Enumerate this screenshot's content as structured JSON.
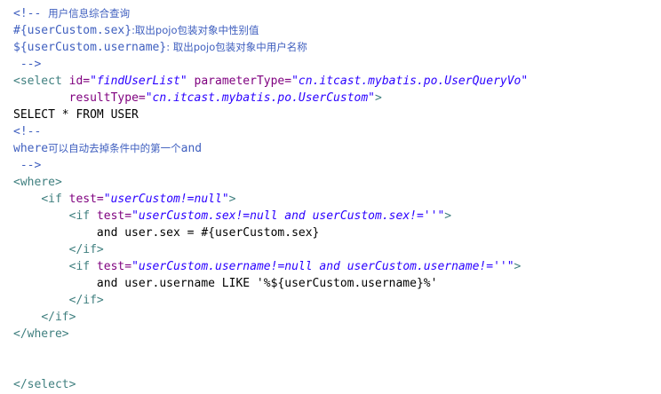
{
  "editor": {
    "lines": [
      {
        "tokens": [
          {
            "text": "<!-- ",
            "kind": "comment"
          },
          {
            "text": "用户信息综合查询",
            "kind": "comment cjk"
          }
        ]
      },
      {
        "tokens": [
          {
            "text": "#{userCustom.sex}",
            "kind": "comment"
          },
          {
            "text": ":取出pojo包装对象中性别值",
            "kind": "comment cjk"
          }
        ]
      },
      {
        "tokens": [
          {
            "text": "${userCustom.username}",
            "kind": "comment"
          },
          {
            "text": ": 取出pojo包装对象中用户名称",
            "kind": "comment cjk"
          }
        ]
      },
      {
        "tokens": [
          {
            "text": " -->",
            "kind": "comment"
          }
        ]
      },
      {
        "tokens": [
          {
            "text": "<select",
            "kind": "tag"
          },
          {
            "text": " ",
            "kind": "plain"
          },
          {
            "text": "id=",
            "kind": "attr"
          },
          {
            "text": "\"findUserList\"",
            "kind": "value"
          },
          {
            "text": " ",
            "kind": "plain"
          },
          {
            "text": "parameterType=",
            "kind": "attr"
          },
          {
            "text": "\"cn.itcast.mybatis.po.UserQueryVo\"",
            "kind": "value"
          }
        ]
      },
      {
        "tokens": [
          {
            "text": "        ",
            "kind": "plain"
          },
          {
            "text": "resultType=",
            "kind": "attr"
          },
          {
            "text": "\"cn.itcast.mybatis.po.UserCustom\"",
            "kind": "value"
          },
          {
            "text": ">",
            "kind": "tag"
          }
        ]
      },
      {
        "tokens": [
          {
            "text": "SELECT * FROM USER",
            "kind": "plain"
          }
        ]
      },
      {
        "tokens": [
          {
            "text": "<!--",
            "kind": "comment"
          }
        ]
      },
      {
        "tokens": [
          {
            "text": "where",
            "kind": "comment"
          },
          {
            "text": "可以自动去掉条件中的第一个",
            "kind": "comment cjk"
          },
          {
            "text": "and",
            "kind": "comment"
          }
        ]
      },
      {
        "tokens": [
          {
            "text": " -->",
            "kind": "comment"
          }
        ]
      },
      {
        "tokens": [
          {
            "text": "<where>",
            "kind": "tag"
          }
        ]
      },
      {
        "tokens": [
          {
            "text": "    ",
            "kind": "plain"
          },
          {
            "text": "<if",
            "kind": "tag"
          },
          {
            "text": " ",
            "kind": "plain"
          },
          {
            "text": "test=",
            "kind": "attr"
          },
          {
            "text": "\"userCustom!=null\"",
            "kind": "value"
          },
          {
            "text": ">",
            "kind": "tag"
          }
        ]
      },
      {
        "tokens": [
          {
            "text": "        ",
            "kind": "plain"
          },
          {
            "text": "<if",
            "kind": "tag"
          },
          {
            "text": " ",
            "kind": "plain"
          },
          {
            "text": "test=",
            "kind": "attr"
          },
          {
            "text": "\"userCustom.sex!=null and userCustom.sex!=''\"",
            "kind": "value"
          },
          {
            "text": ">",
            "kind": "tag"
          }
        ]
      },
      {
        "tokens": [
          {
            "text": "            and user.sex = #{userCustom.sex}",
            "kind": "plain"
          }
        ]
      },
      {
        "tokens": [
          {
            "text": "        ",
            "kind": "plain"
          },
          {
            "text": "</if>",
            "kind": "tag"
          }
        ]
      },
      {
        "tokens": [
          {
            "text": "        ",
            "kind": "plain"
          },
          {
            "text": "<if",
            "kind": "tag"
          },
          {
            "text": " ",
            "kind": "plain"
          },
          {
            "text": "test=",
            "kind": "attr"
          },
          {
            "text": "\"userCustom.username!=null and userCustom.username!=''\"",
            "kind": "value"
          },
          {
            "text": ">",
            "kind": "tag"
          }
        ]
      },
      {
        "tokens": [
          {
            "text": "            and user.username LIKE '%${userCustom.username}%'",
            "kind": "plain"
          }
        ]
      },
      {
        "tokens": [
          {
            "text": "        ",
            "kind": "plain"
          },
          {
            "text": "</if>",
            "kind": "tag"
          }
        ]
      },
      {
        "tokens": [
          {
            "text": "    ",
            "kind": "plain"
          },
          {
            "text": "</if>",
            "kind": "tag"
          }
        ]
      },
      {
        "tokens": [
          {
            "text": "</where>",
            "kind": "tag"
          }
        ]
      },
      {
        "tokens": []
      },
      {
        "tokens": []
      },
      {
        "tokens": [
          {
            "text": "</select>",
            "kind": "tag"
          }
        ]
      }
    ]
  },
  "colors": {
    "comment": "#3f5fbf",
    "tag": "#3f7f7f",
    "attr": "#7f007f",
    "value": "#2a00ff",
    "plain": "#000000",
    "background": "#ffffff"
  }
}
